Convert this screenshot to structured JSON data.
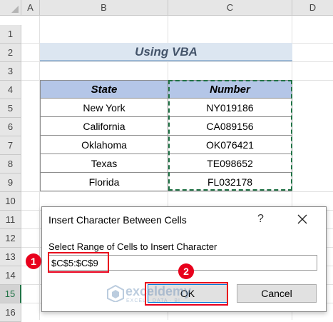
{
  "columns": [
    "A",
    "B",
    "C",
    "D"
  ],
  "rows": [
    "1",
    "2",
    "3",
    "4",
    "5",
    "6",
    "7",
    "8",
    "9",
    "10",
    "11",
    "12",
    "13",
    "14",
    "15",
    "16"
  ],
  "active_row": "15",
  "sheet": {
    "title": "Using VBA",
    "headers": [
      "State",
      "Number"
    ],
    "data": [
      [
        "New York",
        "NY019186"
      ],
      [
        "California",
        "CA089156"
      ],
      [
        "Oklahoma",
        "OK076421"
      ],
      [
        "Texas",
        "TE098652"
      ],
      [
        "Florida",
        "FL032178"
      ]
    ]
  },
  "dialog": {
    "title": "Insert Character Between Cells",
    "help": "?",
    "prompt": "Select Range of Cells to Insert Character",
    "input_value": "$C$5:$C$9",
    "ok_label": "OK",
    "cancel_label": "Cancel"
  },
  "annotations": {
    "badge1": "1",
    "badge2": "2",
    "color": "#e8001c"
  },
  "watermark": {
    "name": "exceldemy",
    "sub": "EXCEL · DATA · BI"
  },
  "colors": {
    "header_fill": "#b4c6e7",
    "title_fill": "#dce6f1",
    "selection": "#217346"
  }
}
